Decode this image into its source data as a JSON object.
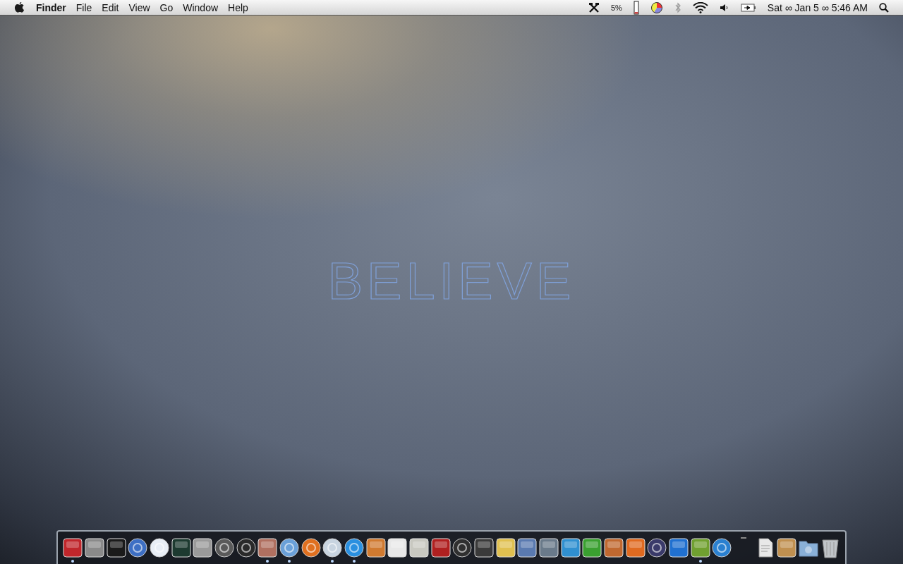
{
  "menubar": {
    "app_name": "Finder",
    "menus": [
      "File",
      "Edit",
      "View",
      "Go",
      "Window",
      "Help"
    ],
    "cpu_reading": "5%",
    "clock": "Sat ∞ Jan 5 ∞ 5:46 AM"
  },
  "wallpaper_text": "BELIEVE",
  "dock": {
    "items": [
      {
        "kind": "tile",
        "color": "#c0262b",
        "running": true
      },
      {
        "kind": "tile",
        "color": "#8a8a8a",
        "running": false
      },
      {
        "kind": "tile",
        "color": "#1a1a1a",
        "running": false
      },
      {
        "kind": "circle",
        "color": "#3d6fc4",
        "running": false
      },
      {
        "kind": "circle",
        "color": "#e8eef6",
        "running": false
      },
      {
        "kind": "tile",
        "color": "#1d3a30",
        "running": false
      },
      {
        "kind": "tile",
        "color": "#9a9a9a",
        "running": false
      },
      {
        "kind": "circle",
        "color": "#5a5a5a",
        "running": false
      },
      {
        "kind": "circle",
        "color": "#2a2a2a",
        "running": false
      },
      {
        "kind": "tile",
        "color": "#b07060",
        "running": true
      },
      {
        "kind": "circle",
        "color": "#6aa0d8",
        "running": true
      },
      {
        "kind": "circle",
        "color": "#e07020",
        "running": false
      },
      {
        "kind": "circle",
        "color": "#c8d4e0",
        "running": true
      },
      {
        "kind": "circle",
        "color": "#2a90e0",
        "running": true
      },
      {
        "kind": "tile",
        "color": "#d07a30",
        "running": false
      },
      {
        "kind": "tile",
        "color": "#e8e8e8",
        "running": false
      },
      {
        "kind": "tile",
        "color": "#c8c8c0",
        "running": false
      },
      {
        "kind": "tile",
        "color": "#b02020",
        "running": false
      },
      {
        "kind": "circle",
        "color": "#303030",
        "running": false
      },
      {
        "kind": "tile",
        "color": "#3a3a3a",
        "running": false
      },
      {
        "kind": "tile",
        "color": "#e0c050",
        "running": false
      },
      {
        "kind": "tile",
        "color": "#5a7ab0",
        "running": false
      },
      {
        "kind": "tile",
        "color": "#6a7a8a",
        "running": false
      },
      {
        "kind": "tile",
        "color": "#3090d0",
        "running": false
      },
      {
        "kind": "tile",
        "color": "#3aa030",
        "running": false
      },
      {
        "kind": "tile",
        "color": "#c06830",
        "running": false
      },
      {
        "kind": "tile",
        "color": "#e06a20",
        "running": false
      },
      {
        "kind": "circle",
        "color": "#3a3a6a",
        "running": false
      },
      {
        "kind": "tile",
        "color": "#2070d0",
        "running": false
      },
      {
        "kind": "tile",
        "color": "#70a030",
        "running": true
      },
      {
        "kind": "circle",
        "color": "#2a80d0",
        "running": false
      },
      {
        "kind": "separator",
        "color": "#888888",
        "running": false
      },
      {
        "kind": "document",
        "color": "#e8e8e8",
        "running": false
      },
      {
        "kind": "tile",
        "color": "#c09050",
        "running": false
      },
      {
        "kind": "folder",
        "color": "#8ab0d8",
        "running": false
      },
      {
        "kind": "trash",
        "color": "#c0c4c8",
        "running": false
      }
    ]
  }
}
